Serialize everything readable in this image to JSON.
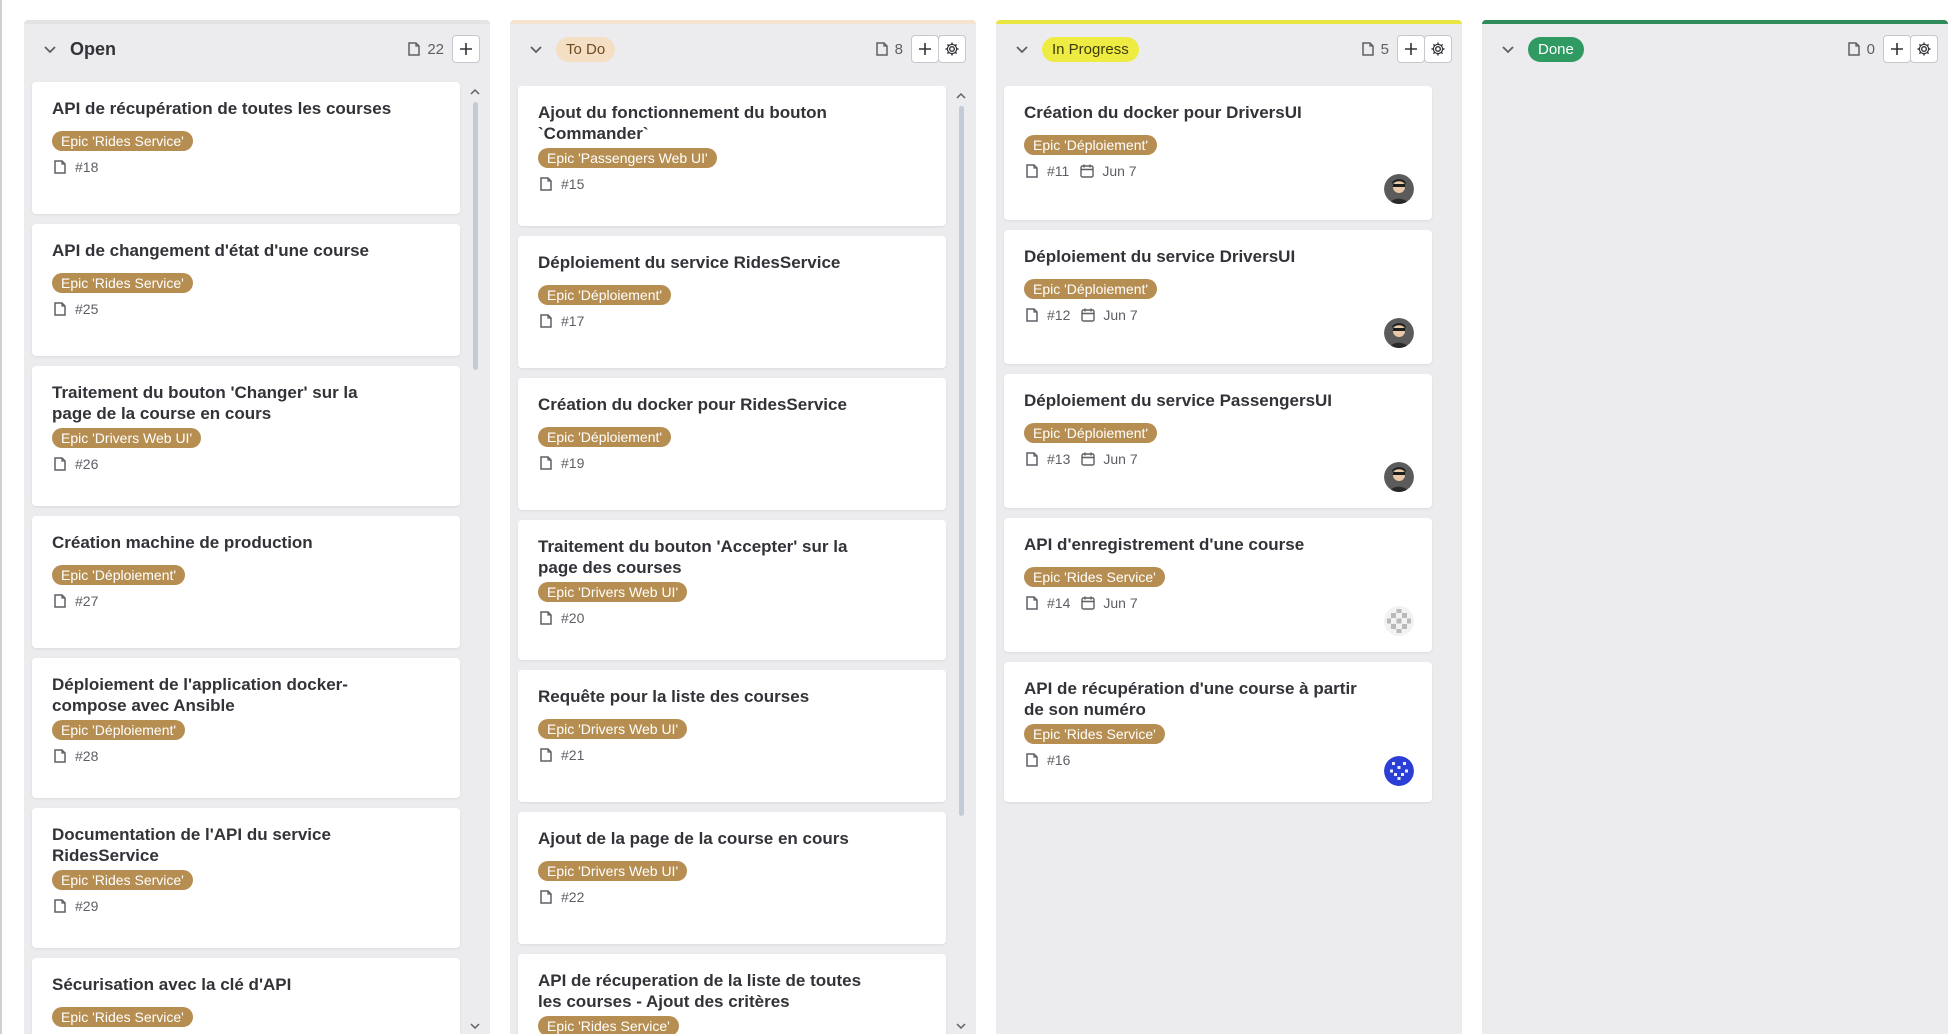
{
  "columns": {
    "open": {
      "title": "Open",
      "count": "22",
      "cards": [
        {
          "title": "API de récupération de toutes les courses",
          "label": "Epic 'Rides Service'",
          "number": "#18"
        },
        {
          "title": "API de changement d'état d'une course",
          "label": "Epic 'Rides Service'",
          "number": "#25"
        },
        {
          "title": "Traitement du bouton 'Changer' sur la page de la course en cours",
          "label": "Epic 'Drivers Web UI'",
          "number": "#26"
        },
        {
          "title": "Création machine de production",
          "label": "Epic 'Déploiement'",
          "number": "#27"
        },
        {
          "title": "Déploiement de l'application docker-compose avec Ansible",
          "label": "Epic 'Déploiement'",
          "number": "#28"
        },
        {
          "title": "Documentation de l'API du service RidesService",
          "label": "Epic 'Rides Service'",
          "number": "#29"
        },
        {
          "title": "Sécurisation avec la clé d'API",
          "label": "Epic 'Rides Service'"
        }
      ]
    },
    "todo": {
      "title": "To Do",
      "count": "8",
      "cards": [
        {
          "title": "Ajout du fonctionnement du bouton `Commander`",
          "label": "Epic 'Passengers Web UI'",
          "number": "#15"
        },
        {
          "title": "Déploiement du service RidesService",
          "label": "Epic 'Déploiement'",
          "number": "#17"
        },
        {
          "title": "Création du docker pour RidesService",
          "label": "Epic 'Déploiement'",
          "number": "#19"
        },
        {
          "title": "Traitement du bouton 'Accepter' sur la page des courses",
          "label": "Epic 'Drivers Web UI'",
          "number": "#20"
        },
        {
          "title": "Requête pour la liste des courses",
          "label": "Epic 'Drivers Web UI'",
          "number": "#21"
        },
        {
          "title": "Ajout de la page de la course en cours",
          "label": "Epic 'Drivers Web UI'",
          "number": "#22"
        },
        {
          "title": "API de récuperation de la liste de toutes les courses - Ajout des critères",
          "label": "Epic 'Rides Service'"
        }
      ]
    },
    "inprogress": {
      "title": "In Progress",
      "count": "5",
      "cards": [
        {
          "title": "Création du docker pour DriversUI",
          "label": "Epic 'Déploiement'",
          "number": "#11",
          "due": "Jun 7"
        },
        {
          "title": "Déploiement du service DriversUI",
          "label": "Epic 'Déploiement'",
          "number": "#12",
          "due": "Jun 7"
        },
        {
          "title": "Déploiement du service PassengersUI",
          "label": "Epic 'Déploiement'",
          "number": "#13",
          "due": "Jun 7"
        },
        {
          "title": "API d'enregistrement d'une course",
          "label": "Epic 'Rides Service'",
          "number": "#14",
          "due": "Jun 7"
        },
        {
          "title": "API de récupération d'une course à partir de son numéro",
          "label": "Epic 'Rides Service'",
          "number": "#16"
        }
      ]
    },
    "done": {
      "title": "Done",
      "count": "0"
    }
  },
  "colors": {
    "label": "#b68e52",
    "todo_pill": "#f5dfc4",
    "inprogress_pill": "#eeeb43",
    "done_pill": "#2f9a61"
  }
}
